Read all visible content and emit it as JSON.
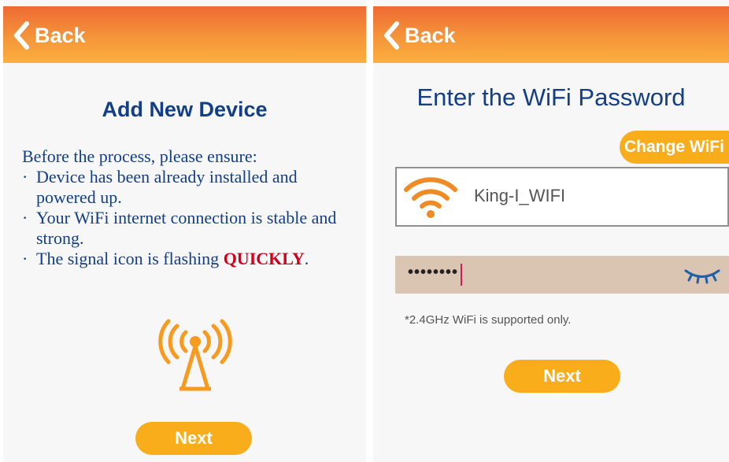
{
  "left_screen": {
    "back_label": "Back",
    "title": "Add New Device",
    "intro": "Before the process, please ensure:",
    "bullets": [
      "Device has been already installed and powered up.",
      "Your WiFi internet connection is stable and strong."
    ],
    "last_bullet_prefix": "The signal icon is flashing ",
    "last_bullet_emphasis": "QUICKLY",
    "last_bullet_suffix": ".",
    "bullet_char": "·",
    "icon": "signal-tower-icon",
    "next_label": "Next"
  },
  "right_screen": {
    "back_label": "Back",
    "title": "Enter the WiFi Password",
    "change_wifi_label": "Change WiFi",
    "wifi_icon": "wifi-icon",
    "wifi_name": "King-I_WIFI",
    "password_value": "••••••••",
    "eye_icon": "eye-closed-icon",
    "note": "*2.4GHz WiFi is supported only.",
    "next_label": "Next"
  },
  "colors": {
    "header_top": "#ee6a33",
    "header_bottom": "#fbb03e",
    "title_blue": "#123f88",
    "button_yellow": "#f9ad1b",
    "emphasis_red": "#d0021b",
    "password_field": "#d9c5b2",
    "icon_orange": "#f79a1e"
  }
}
